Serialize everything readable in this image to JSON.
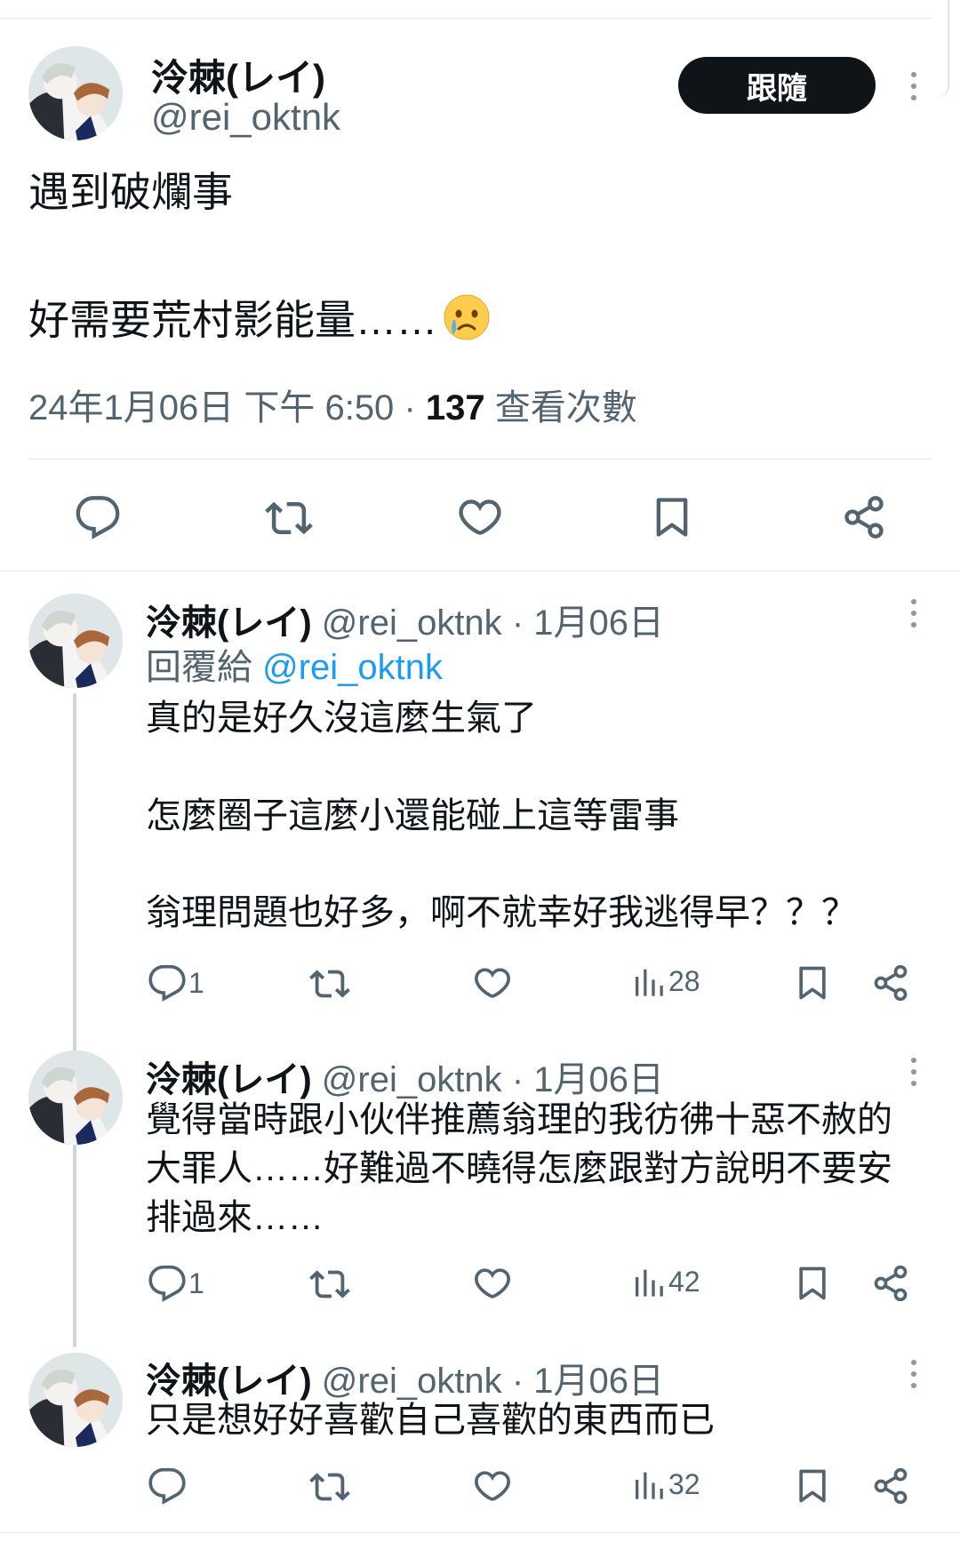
{
  "main_tweet": {
    "author_name": "泠棘(レイ)",
    "author_handle": "@rei_oktnk",
    "follow_label": "跟隨",
    "text_lines": [
      "遇到破爛事",
      "好需要荒村影能量……"
    ],
    "emoji": "crying-face",
    "timestamp": "24年1月06日 下午 6:50",
    "separator": "·",
    "view_count": "137",
    "view_label": "查看次數",
    "actions": [
      "reply",
      "retweet",
      "like",
      "bookmark",
      "share"
    ]
  },
  "replies": [
    {
      "author_name": "泠棘(レイ)",
      "author_handle": "@rei_oktnk",
      "date": "1月06日",
      "replying_to_label": "回覆給",
      "replying_to_handle": "@rei_oktnk",
      "text_lines": [
        "真的是好久沒這麼生氣了",
        "",
        "怎麼圈子這麼小還能碰上這等雷事",
        "",
        "翁理問題也好多，啊不就幸好我逃得早？？？"
      ],
      "reply_count": "1",
      "views": "28"
    },
    {
      "author_name": "泠棘(レイ)",
      "author_handle": "@rei_oktnk",
      "date": "1月06日",
      "text_lines": [
        "覺得當時跟小伙伴推薦翁理的我彷彿十惡不赦的",
        "大罪人……好難過不曉得怎麼跟對方說明不要安",
        "排過來……"
      ],
      "reply_count": "1",
      "views": "42"
    },
    {
      "author_name": "泠棘(レイ)",
      "author_handle": "@rei_oktnk",
      "date": "1月06日",
      "text_lines": [
        "只是想好好喜歡自己喜歡的東西而已"
      ],
      "reply_count": "",
      "views": "32"
    }
  ],
  "icons": {
    "reply": "reply-icon",
    "retweet": "retweet-icon",
    "like": "like-icon",
    "views": "views-icon",
    "bookmark": "bookmark-icon",
    "share": "share-icon",
    "more": "more-icon"
  },
  "colors": {
    "text": "#0f1419",
    "muted": "#536471",
    "link": "#1d9bf0",
    "button": "#0f1419",
    "thread": "#d0d7dc"
  }
}
